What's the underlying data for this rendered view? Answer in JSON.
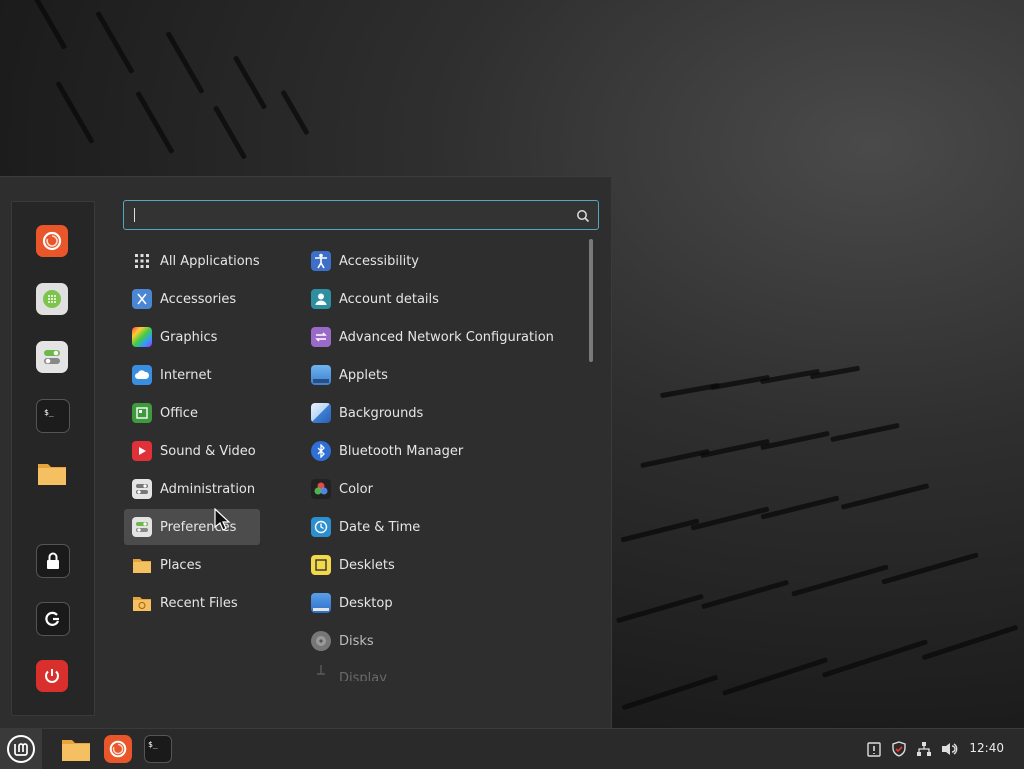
{
  "search": {
    "placeholder": "",
    "value": ""
  },
  "categories": [
    {
      "label": "All Applications",
      "icon": "grid-icon"
    },
    {
      "label": "Accessories",
      "icon": "accessories-icon"
    },
    {
      "label": "Graphics",
      "icon": "graphics-icon"
    },
    {
      "label": "Internet",
      "icon": "internet-icon"
    },
    {
      "label": "Office",
      "icon": "office-icon"
    },
    {
      "label": "Sound & Video",
      "icon": "sound-video-icon"
    },
    {
      "label": "Administration",
      "icon": "administration-icon"
    },
    {
      "label": "Preferences",
      "icon": "preferences-icon",
      "highlighted": true
    },
    {
      "label": "Places",
      "icon": "folder-icon"
    },
    {
      "label": "Recent Files",
      "icon": "recent-files-icon"
    }
  ],
  "apps": [
    {
      "label": "Accessibility",
      "icon": "accessibility-icon"
    },
    {
      "label": "Account details",
      "icon": "account-icon"
    },
    {
      "label": "Advanced Network Configuration",
      "icon": "network-config-icon"
    },
    {
      "label": "Applets",
      "icon": "applets-icon"
    },
    {
      "label": "Backgrounds",
      "icon": "backgrounds-icon"
    },
    {
      "label": "Bluetooth Manager",
      "icon": "bluetooth-icon"
    },
    {
      "label": "Color",
      "icon": "color-icon"
    },
    {
      "label": "Date & Time",
      "icon": "clock-icon"
    },
    {
      "label": "Desklets",
      "icon": "desklets-icon"
    },
    {
      "label": "Desktop",
      "icon": "desktop-icon"
    },
    {
      "label": "Disks",
      "icon": "disks-icon"
    },
    {
      "label": "Display",
      "icon": "display-icon"
    }
  ],
  "favorites": [
    {
      "name": "firefox",
      "icon": "firefox-icon"
    },
    {
      "name": "software-manager",
      "icon": "software-manager-icon"
    },
    {
      "name": "system-settings",
      "icon": "settings-toggle-icon"
    },
    {
      "name": "terminal",
      "icon": "terminal-icon"
    },
    {
      "name": "files",
      "icon": "folder-icon"
    },
    {
      "name": "lock-screen",
      "icon": "lock-icon"
    },
    {
      "name": "logout",
      "icon": "logout-icon"
    },
    {
      "name": "shutdown",
      "icon": "power-icon"
    }
  ],
  "panel": {
    "clock": "12:40",
    "launchers": [
      "files",
      "firefox",
      "terminal"
    ],
    "tray": [
      "update-icon",
      "shield-icon",
      "network-icon",
      "volume-icon"
    ]
  },
  "colors": {
    "accent": "#56a6c1",
    "menu_bg": "#2e2e2e",
    "panel_bg": "#2a2a2a",
    "highlight": "#4c4c4c"
  }
}
